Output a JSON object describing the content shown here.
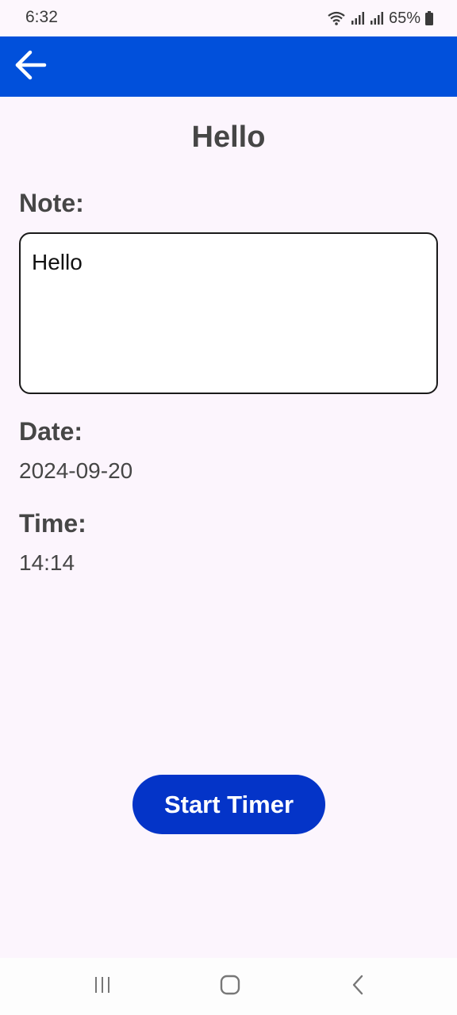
{
  "status_bar": {
    "time": "6:32",
    "battery": "65%",
    "icons": [
      "wifi-icon",
      "signal-icon",
      "signal-icon",
      "battery-icon"
    ]
  },
  "app_bar": {
    "back_icon": "arrow-left-icon",
    "color": "#0150db"
  },
  "title": "Hello",
  "note": {
    "label": "Note:",
    "value": "Hello"
  },
  "date": {
    "label": "Date:",
    "value": "2024-09-20"
  },
  "time": {
    "label": "Time:",
    "value": "14:14"
  },
  "start_button": {
    "label": "Start Timer",
    "color": "#0434c8"
  },
  "nav_bar": {
    "icons": [
      "recent-apps-icon",
      "home-icon",
      "back-icon"
    ]
  }
}
